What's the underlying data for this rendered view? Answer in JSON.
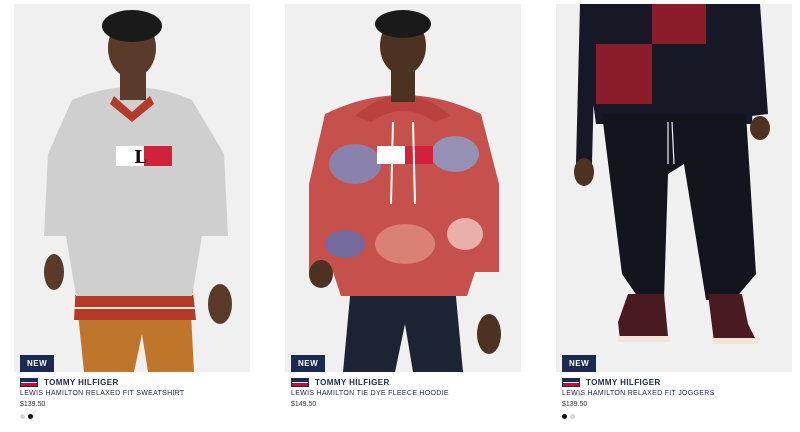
{
  "products": [
    {
      "badge": "NEW",
      "brand": "TOMMY HILFIGER",
      "name": "LEWIS HAMILTON RELAXED FIT SWEATSHIRT",
      "price": "$139.50",
      "swatches": [
        "#d7d7d7",
        "#111111"
      ]
    },
    {
      "badge": "NEW",
      "brand": "TOMMY HILFIGER",
      "name": "LEWIS HAMILTON TIE DYE FLEECE HOODIE",
      "price": "$149.50",
      "swatches": []
    },
    {
      "badge": "NEW",
      "brand": "TOMMY HILFIGER",
      "name": "LEWIS HAMILTON RELAXED FIT JOGGERS",
      "price": "$139.50",
      "swatches": [
        "#111111",
        "#d7d7d7"
      ]
    }
  ],
  "colors": {
    "badge_bg": "#1b2a51",
    "brand_navy": "#1b2a51",
    "brand_red": "#cc0c2f"
  }
}
